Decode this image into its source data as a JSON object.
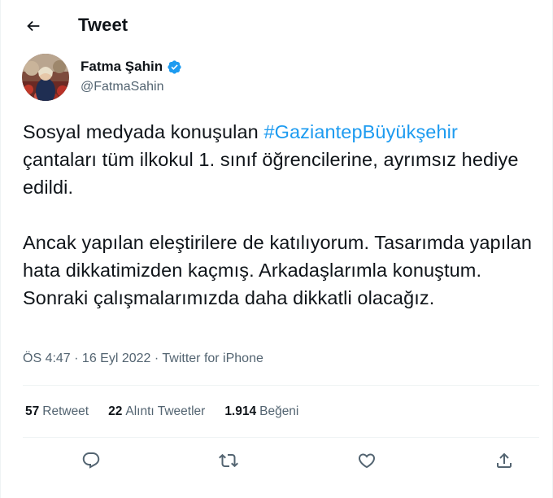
{
  "header": {
    "title": "Tweet",
    "back_icon": "arrow-left-icon"
  },
  "author": {
    "name": "Fatma Şahin",
    "handle": "@FatmaSahin",
    "verified_icon": "verified-badge-icon",
    "verified_color": "#1d9bf0"
  },
  "tweet": {
    "line1_prefix": "Sosyal medyada konuşulan ",
    "hashtag": "#GaziantepBüyükşehir",
    "line1_rest": "çantaları tüm ilkokul 1. sınıf öğrencilerine, ayrımsız hediye edildi.",
    "paragraph2": "Ancak yapılan eleştirilere de katılıyorum. Tasarımda yapılan hata dikkatimizden kaçmış. Arkadaşlarımla konuştum. Sonraki çalışmalarımızda daha dikkatli olacağız."
  },
  "meta": {
    "time": "ÖS 4:47",
    "sep": " · ",
    "date": "16 Eyl 2022",
    "source": "Twitter for iPhone"
  },
  "stats": {
    "retweets_count": "57",
    "retweets_label": "Retweet",
    "quotes_count": "22",
    "quotes_label": "Alıntı Tweetler",
    "likes_count": "1.914",
    "likes_label": "Beğeni"
  },
  "actions": {
    "reply_icon": "reply-icon",
    "retweet_icon": "retweet-icon",
    "like_icon": "heart-icon",
    "share_icon": "share-icon"
  },
  "colors": {
    "accent": "#1d9bf0",
    "text_primary": "#0f1419",
    "text_secondary": "#536471",
    "divider": "#eff3f4"
  }
}
